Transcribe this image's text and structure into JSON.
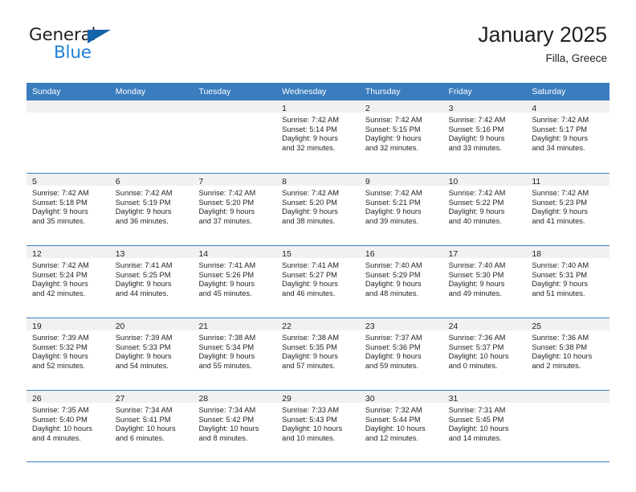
{
  "brand": {
    "logo_line1": "General",
    "logo_line2": "Blue",
    "logo_color_dark": "#231f20",
    "logo_color_blue": "#1f7fd4",
    "logo_triangle_color": "#1464aa"
  },
  "header": {
    "title": "January 2025",
    "subtitle": "Filla, Greece"
  },
  "theme": {
    "header_row_bg": "#3a7dbf",
    "header_row_text": "#ffffff",
    "day_band_bg": "#f1f1f1",
    "grid_line": "#3a7dbf",
    "body_text": "#231f20"
  },
  "weekdays": [
    "Sunday",
    "Monday",
    "Tuesday",
    "Wednesday",
    "Thursday",
    "Friday",
    "Saturday"
  ],
  "weeks": [
    [
      {
        "day": "",
        "empty": true,
        "sunrise": "",
        "sunset": "",
        "daylight_1": "",
        "daylight_2": ""
      },
      {
        "day": "",
        "empty": true,
        "sunrise": "",
        "sunset": "",
        "daylight_1": "",
        "daylight_2": ""
      },
      {
        "day": "",
        "empty": true,
        "sunrise": "",
        "sunset": "",
        "daylight_1": "",
        "daylight_2": ""
      },
      {
        "day": "1",
        "empty": false,
        "sunrise": "Sunrise: 7:42 AM",
        "sunset": "Sunset: 5:14 PM",
        "daylight_1": "Daylight: 9 hours",
        "daylight_2": "and 32 minutes."
      },
      {
        "day": "2",
        "empty": false,
        "sunrise": "Sunrise: 7:42 AM",
        "sunset": "Sunset: 5:15 PM",
        "daylight_1": "Daylight: 9 hours",
        "daylight_2": "and 32 minutes."
      },
      {
        "day": "3",
        "empty": false,
        "sunrise": "Sunrise: 7:42 AM",
        "sunset": "Sunset: 5:16 PM",
        "daylight_1": "Daylight: 9 hours",
        "daylight_2": "and 33 minutes."
      },
      {
        "day": "4",
        "empty": false,
        "sunrise": "Sunrise: 7:42 AM",
        "sunset": "Sunset: 5:17 PM",
        "daylight_1": "Daylight: 9 hours",
        "daylight_2": "and 34 minutes."
      }
    ],
    [
      {
        "day": "5",
        "empty": false,
        "sunrise": "Sunrise: 7:42 AM",
        "sunset": "Sunset: 5:18 PM",
        "daylight_1": "Daylight: 9 hours",
        "daylight_2": "and 35 minutes."
      },
      {
        "day": "6",
        "empty": false,
        "sunrise": "Sunrise: 7:42 AM",
        "sunset": "Sunset: 5:19 PM",
        "daylight_1": "Daylight: 9 hours",
        "daylight_2": "and 36 minutes."
      },
      {
        "day": "7",
        "empty": false,
        "sunrise": "Sunrise: 7:42 AM",
        "sunset": "Sunset: 5:20 PM",
        "daylight_1": "Daylight: 9 hours",
        "daylight_2": "and 37 minutes."
      },
      {
        "day": "8",
        "empty": false,
        "sunrise": "Sunrise: 7:42 AM",
        "sunset": "Sunset: 5:20 PM",
        "daylight_1": "Daylight: 9 hours",
        "daylight_2": "and 38 minutes."
      },
      {
        "day": "9",
        "empty": false,
        "sunrise": "Sunrise: 7:42 AM",
        "sunset": "Sunset: 5:21 PM",
        "daylight_1": "Daylight: 9 hours",
        "daylight_2": "and 39 minutes."
      },
      {
        "day": "10",
        "empty": false,
        "sunrise": "Sunrise: 7:42 AM",
        "sunset": "Sunset: 5:22 PM",
        "daylight_1": "Daylight: 9 hours",
        "daylight_2": "and 40 minutes."
      },
      {
        "day": "11",
        "empty": false,
        "sunrise": "Sunrise: 7:42 AM",
        "sunset": "Sunset: 5:23 PM",
        "daylight_1": "Daylight: 9 hours",
        "daylight_2": "and 41 minutes."
      }
    ],
    [
      {
        "day": "12",
        "empty": false,
        "sunrise": "Sunrise: 7:42 AM",
        "sunset": "Sunset: 5:24 PM",
        "daylight_1": "Daylight: 9 hours",
        "daylight_2": "and 42 minutes."
      },
      {
        "day": "13",
        "empty": false,
        "sunrise": "Sunrise: 7:41 AM",
        "sunset": "Sunset: 5:25 PM",
        "daylight_1": "Daylight: 9 hours",
        "daylight_2": "and 44 minutes."
      },
      {
        "day": "14",
        "empty": false,
        "sunrise": "Sunrise: 7:41 AM",
        "sunset": "Sunset: 5:26 PM",
        "daylight_1": "Daylight: 9 hours",
        "daylight_2": "and 45 minutes."
      },
      {
        "day": "15",
        "empty": false,
        "sunrise": "Sunrise: 7:41 AM",
        "sunset": "Sunset: 5:27 PM",
        "daylight_1": "Daylight: 9 hours",
        "daylight_2": "and 46 minutes."
      },
      {
        "day": "16",
        "empty": false,
        "sunrise": "Sunrise: 7:40 AM",
        "sunset": "Sunset: 5:29 PM",
        "daylight_1": "Daylight: 9 hours",
        "daylight_2": "and 48 minutes."
      },
      {
        "day": "17",
        "empty": false,
        "sunrise": "Sunrise: 7:40 AM",
        "sunset": "Sunset: 5:30 PM",
        "daylight_1": "Daylight: 9 hours",
        "daylight_2": "and 49 minutes."
      },
      {
        "day": "18",
        "empty": false,
        "sunrise": "Sunrise: 7:40 AM",
        "sunset": "Sunset: 5:31 PM",
        "daylight_1": "Daylight: 9 hours",
        "daylight_2": "and 51 minutes."
      }
    ],
    [
      {
        "day": "19",
        "empty": false,
        "sunrise": "Sunrise: 7:39 AM",
        "sunset": "Sunset: 5:32 PM",
        "daylight_1": "Daylight: 9 hours",
        "daylight_2": "and 52 minutes."
      },
      {
        "day": "20",
        "empty": false,
        "sunrise": "Sunrise: 7:39 AM",
        "sunset": "Sunset: 5:33 PM",
        "daylight_1": "Daylight: 9 hours",
        "daylight_2": "and 54 minutes."
      },
      {
        "day": "21",
        "empty": false,
        "sunrise": "Sunrise: 7:38 AM",
        "sunset": "Sunset: 5:34 PM",
        "daylight_1": "Daylight: 9 hours",
        "daylight_2": "and 55 minutes."
      },
      {
        "day": "22",
        "empty": false,
        "sunrise": "Sunrise: 7:38 AM",
        "sunset": "Sunset: 5:35 PM",
        "daylight_1": "Daylight: 9 hours",
        "daylight_2": "and 57 minutes."
      },
      {
        "day": "23",
        "empty": false,
        "sunrise": "Sunrise: 7:37 AM",
        "sunset": "Sunset: 5:36 PM",
        "daylight_1": "Daylight: 9 hours",
        "daylight_2": "and 59 minutes."
      },
      {
        "day": "24",
        "empty": false,
        "sunrise": "Sunrise: 7:36 AM",
        "sunset": "Sunset: 5:37 PM",
        "daylight_1": "Daylight: 10 hours",
        "daylight_2": "and 0 minutes."
      },
      {
        "day": "25",
        "empty": false,
        "sunrise": "Sunrise: 7:36 AM",
        "sunset": "Sunset: 5:38 PM",
        "daylight_1": "Daylight: 10 hours",
        "daylight_2": "and 2 minutes."
      }
    ],
    [
      {
        "day": "26",
        "empty": false,
        "sunrise": "Sunrise: 7:35 AM",
        "sunset": "Sunset: 5:40 PM",
        "daylight_1": "Daylight: 10 hours",
        "daylight_2": "and 4 minutes."
      },
      {
        "day": "27",
        "empty": false,
        "sunrise": "Sunrise: 7:34 AM",
        "sunset": "Sunset: 5:41 PM",
        "daylight_1": "Daylight: 10 hours",
        "daylight_2": "and 6 minutes."
      },
      {
        "day": "28",
        "empty": false,
        "sunrise": "Sunrise: 7:34 AM",
        "sunset": "Sunset: 5:42 PM",
        "daylight_1": "Daylight: 10 hours",
        "daylight_2": "and 8 minutes."
      },
      {
        "day": "29",
        "empty": false,
        "sunrise": "Sunrise: 7:33 AM",
        "sunset": "Sunset: 5:43 PM",
        "daylight_1": "Daylight: 10 hours",
        "daylight_2": "and 10 minutes."
      },
      {
        "day": "30",
        "empty": false,
        "sunrise": "Sunrise: 7:32 AM",
        "sunset": "Sunset: 5:44 PM",
        "daylight_1": "Daylight: 10 hours",
        "daylight_2": "and 12 minutes."
      },
      {
        "day": "31",
        "empty": false,
        "sunrise": "Sunrise: 7:31 AM",
        "sunset": "Sunset: 5:45 PM",
        "daylight_1": "Daylight: 10 hours",
        "daylight_2": "and 14 minutes."
      },
      {
        "day": "",
        "empty": true,
        "sunrise": "",
        "sunset": "",
        "daylight_1": "",
        "daylight_2": ""
      }
    ]
  ]
}
